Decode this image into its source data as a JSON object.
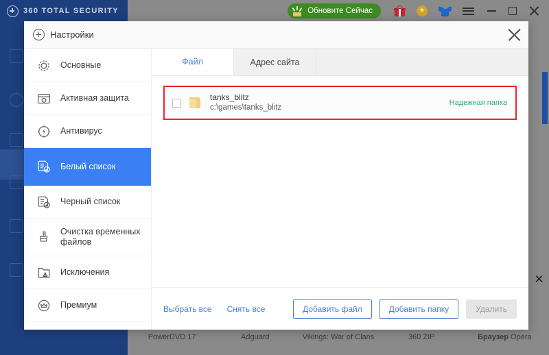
{
  "titlebar": {
    "brand": "360 TOTAL SECURITY",
    "logo_icon": "plus-circle-icon",
    "update_button": "Обновите Сейчас",
    "icons": [
      "gift-icon",
      "coin-icon",
      "tshirt-icon",
      "hamburger-menu-icon"
    ],
    "window_controls": [
      "minimize-button",
      "maximize-button",
      "close-button"
    ]
  },
  "background": {
    "close_icon": "close-icon",
    "tiles": [
      {
        "label": "PowerDVD 17",
        "bold": ""
      },
      {
        "label": "Adguard",
        "bold": ""
      },
      {
        "label": "Vikings: War of Clans",
        "bold": ""
      },
      {
        "label": "360 ZIP",
        "bold": ""
      },
      {
        "label": "Opera",
        "bold": "Браузер"
      }
    ]
  },
  "dialog": {
    "title": "Настройки",
    "title_icon": "plus-circle-icon",
    "close_icon": "close-icon",
    "sidebar": [
      {
        "label": "Основные",
        "icon": "gear-icon",
        "active": false
      },
      {
        "label": "Активная защита",
        "icon": "shield-window-icon",
        "active": false
      },
      {
        "label": "Антивирус",
        "icon": "bolt-circle-icon",
        "active": false
      },
      {
        "label": "Белый список",
        "icon": "document-check-icon",
        "active": true
      },
      {
        "label": "Черный список",
        "icon": "document-block-icon",
        "active": false
      },
      {
        "label": "Очистка временных файлов",
        "icon": "broom-icon",
        "active": false
      },
      {
        "label": "Исключения",
        "icon": "folder-warning-icon",
        "active": false
      },
      {
        "label": "Премиум",
        "icon": "crown-circle-icon",
        "active": false
      }
    ],
    "tabs": [
      {
        "label": "Файл",
        "active": true
      },
      {
        "label": "Адрес сайта",
        "active": false
      }
    ],
    "file_rows": [
      {
        "name": "tanks_blitz",
        "path": "c:\\games\\tanks_blitz",
        "tag": "Надежная папка",
        "checked": false,
        "icon": "folder-icon",
        "highlighted": true
      }
    ],
    "footer": {
      "select_all": "Выбрать все",
      "deselect_all": "Снять все",
      "add_file": "Добавить файл",
      "add_folder": "Добавить папку",
      "delete": "Удалить"
    }
  },
  "colors": {
    "brand_blue": "#1d3f7e",
    "accent_blue": "#3b7ff5",
    "link_blue": "#4a7fd4",
    "highlight_red": "#e8262a",
    "tag_green": "#2aa884",
    "update_green": "#3d8b23"
  }
}
